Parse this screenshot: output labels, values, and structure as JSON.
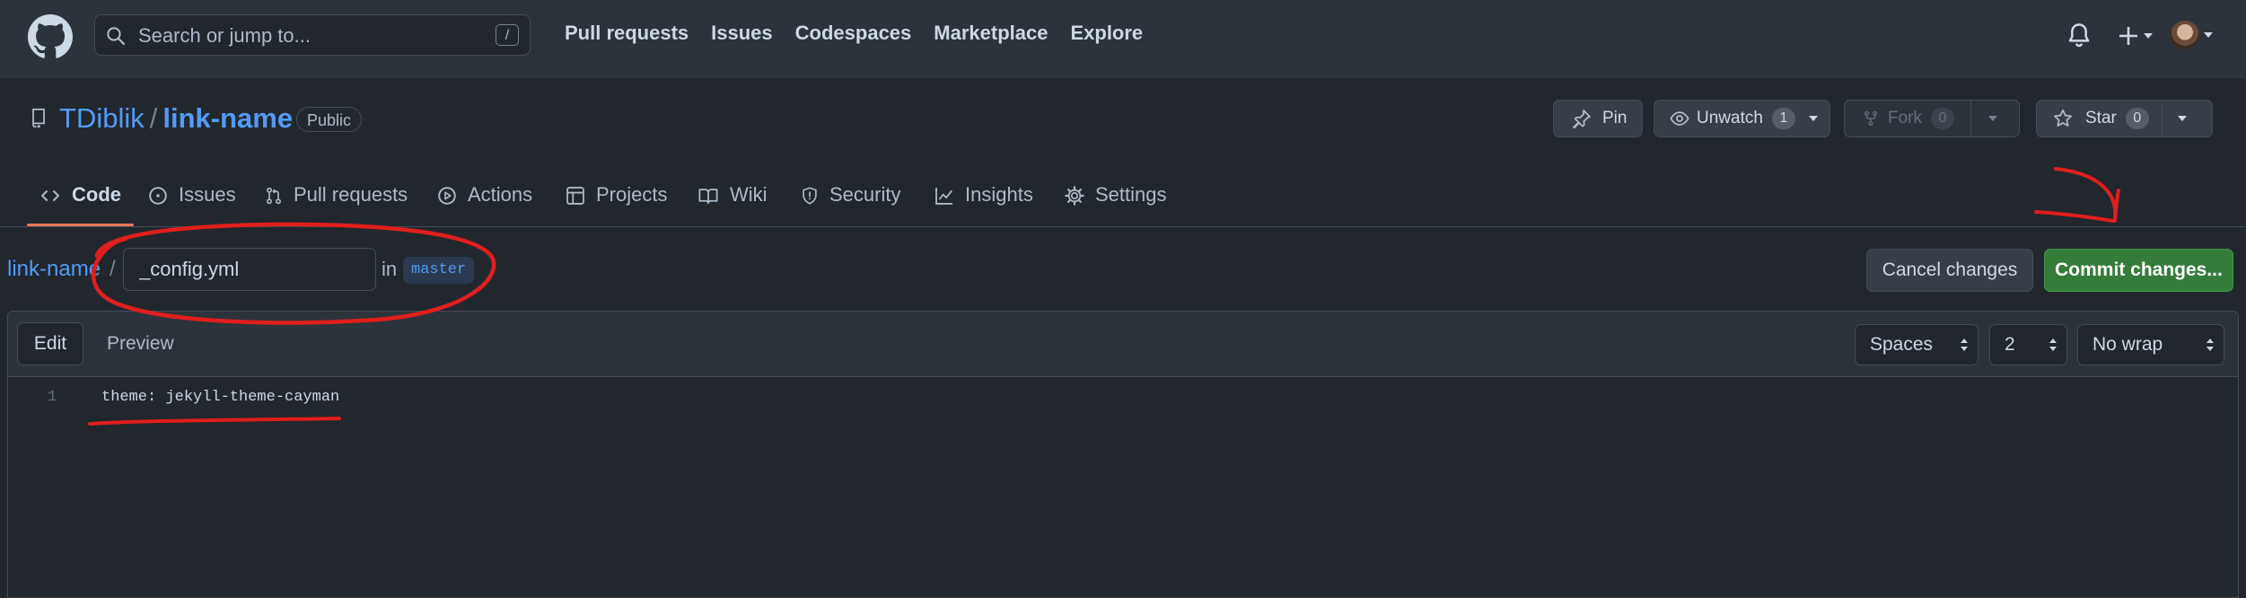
{
  "header": {
    "search_placeholder": "Search or jump to...",
    "search_shortcut": "/",
    "nav": [
      "Pull requests",
      "Issues",
      "Codespaces",
      "Marketplace",
      "Explore"
    ]
  },
  "repo": {
    "owner": "TDiblik",
    "separator": "/",
    "name": "link-name",
    "visibility": "Public",
    "actions": {
      "pin": "Pin",
      "unwatch": "Unwatch",
      "watch_count": "1",
      "fork": "Fork",
      "fork_count": "0",
      "star": "Star",
      "star_count": "0"
    }
  },
  "tabs": [
    {
      "label": "Code",
      "icon": "code-icon",
      "active": true
    },
    {
      "label": "Issues",
      "icon": "issue-icon"
    },
    {
      "label": "Pull requests",
      "icon": "pull-request-icon"
    },
    {
      "label": "Actions",
      "icon": "play-icon"
    },
    {
      "label": "Projects",
      "icon": "table-icon"
    },
    {
      "label": "Wiki",
      "icon": "book-icon"
    },
    {
      "label": "Security",
      "icon": "shield-icon"
    },
    {
      "label": "Insights",
      "icon": "graph-icon"
    },
    {
      "label": "Settings",
      "icon": "gear-icon"
    }
  ],
  "edit_bar": {
    "breadcrumb_repo": "link-name",
    "breadcrumb_sep": "/",
    "filename": "_config.yml",
    "in_label": "in",
    "branch": "master",
    "cancel_label": "Cancel changes",
    "commit_label": "Commit changes..."
  },
  "editor": {
    "edit_tab": "Edit",
    "preview_tab": "Preview",
    "indent_mode": "Spaces",
    "indent_size": "2",
    "wrap_mode": "No wrap",
    "lines": [
      {
        "number": "1",
        "text": "theme: jekyll-theme-cayman"
      }
    ]
  },
  "colors": {
    "accent_link": "#539bf5",
    "commit_green": "#347d39",
    "annotation_red": "#e01e1e"
  }
}
